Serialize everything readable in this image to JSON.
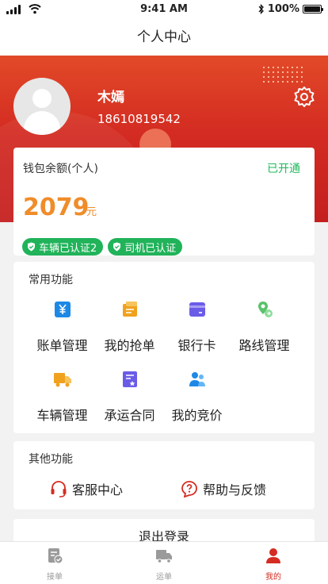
{
  "status_bar": {
    "time": "9:41 AM",
    "battery": "100%",
    "battery_level": 1.0
  },
  "header": {
    "title": "个人中心"
  },
  "profile": {
    "name": "木嫣",
    "phone": "18610819542"
  },
  "wallet": {
    "label": "钱包余额(个人)",
    "status": "已开通",
    "amount": "2079",
    "unit": "元"
  },
  "badges": [
    {
      "label": "车辆已认证2",
      "icon": "shield-check-icon"
    },
    {
      "label": "司机已认证",
      "icon": "shield-check-icon"
    }
  ],
  "common": {
    "title": "常用功能",
    "items": [
      {
        "label": "账单管理",
        "icon": "yen-icon",
        "color": "#1e88e5"
      },
      {
        "label": "我的抢单",
        "icon": "order-icon",
        "color": "#f0a21e"
      },
      {
        "label": "银行卡",
        "icon": "bank-card-icon",
        "color": "#6b5ce7"
      },
      {
        "label": "路线管理",
        "icon": "route-icon",
        "color": "#58c26b"
      },
      {
        "label": "车辆管理",
        "icon": "truck-icon",
        "color": "#f0a21e"
      },
      {
        "label": "承运合同",
        "icon": "contract-icon",
        "color": "#6b5ce7"
      },
      {
        "label": "我的竞价",
        "icon": "bid-icon",
        "color": "#1e88e5"
      }
    ]
  },
  "other": {
    "title": "其他功能",
    "items": [
      {
        "label": "客服中心",
        "icon": "headset-icon"
      },
      {
        "label": "帮助与反馈",
        "icon": "help-icon"
      }
    ]
  },
  "logout": {
    "label": "退出登录"
  },
  "tabs": [
    {
      "label": "接单",
      "icon": "accept-order-icon"
    },
    {
      "label": "运单",
      "icon": "waybill-truck-icon"
    },
    {
      "label": "我的",
      "icon": "profile-icon",
      "active": true
    }
  ],
  "colors": {
    "brand_red": "#d42c22",
    "accent_orange": "#f08c2a",
    "success_green": "#1fb85c"
  }
}
